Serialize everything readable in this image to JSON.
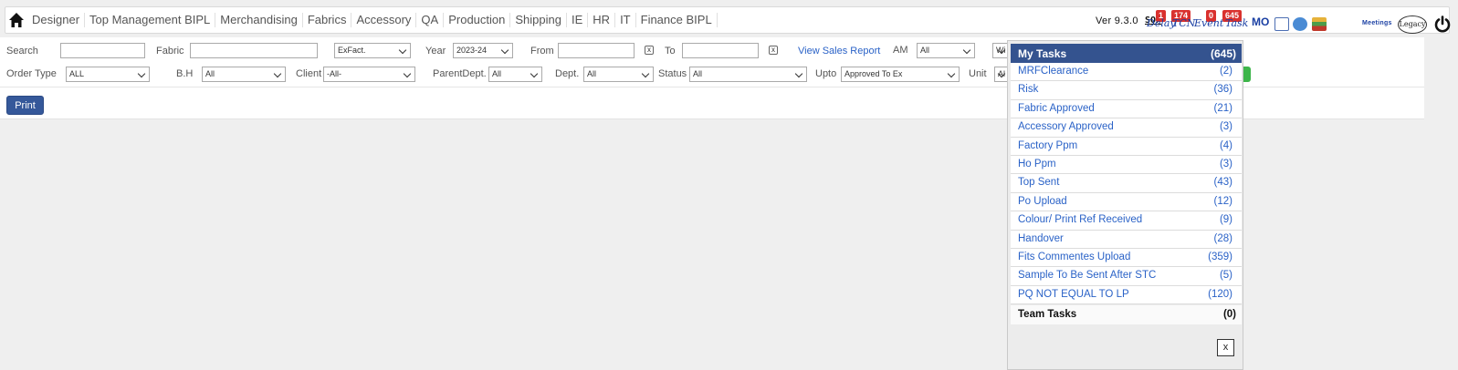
{
  "nav": {
    "items": [
      "Designer",
      "Top Management BIPL",
      "Merchandising",
      "Fabrics",
      "Accessory",
      "QA",
      "Production",
      "Shipping",
      "IE",
      "HR",
      "IT",
      "Finance BIPL"
    ],
    "version": "Ver 9.3.0",
    "sop": "SOP",
    "delay_label": "Delay",
    "delay_count": "1",
    "tcn_label": "TCN",
    "tcn_count": "174",
    "event_label": "Event",
    "event_count": "0",
    "task_label": "Task",
    "task_count": "645",
    "mo_label": "MO",
    "meetings": "Meetings",
    "legacy": "Legacy"
  },
  "filters": {
    "search_label": "Search",
    "fabric_label": "Fabric",
    "exfact_value": "ExFact.",
    "year_label": "Year",
    "year_value": "2023-24",
    "from_label": "From",
    "to_label": "To",
    "view_sales_report": "View Sales Report",
    "am_label": "AM",
    "am_value": "All",
    "wi_value": "Wi",
    "order_type_label": "Order Type",
    "order_type_value": "ALL",
    "bh_label": "B.H",
    "bh_value": "All",
    "client_label": "Client",
    "client_value": "-All-",
    "parent_dept_label": "ParentDept.",
    "parent_dept_value": "All",
    "dept_label": "Dept.",
    "dept_value": "All",
    "status_label": "Status",
    "status_value": "All",
    "upto_label": "Upto",
    "upto_value": "Approved To Ex",
    "unit_label": "Unit",
    "unit_value": "Al",
    "print_label": "Print"
  },
  "tasks": {
    "header_label": "My Tasks",
    "header_count": "(645)",
    "items": [
      {
        "label": "MRFClearance",
        "count": "(2)"
      },
      {
        "label": "Risk",
        "count": "(36)"
      },
      {
        "label": "Fabric Approved",
        "count": "(21)"
      },
      {
        "label": "Accessory Approved",
        "count": "(3)"
      },
      {
        "label": "Factory Ppm",
        "count": "(4)"
      },
      {
        "label": "Ho Ppm",
        "count": "(3)"
      },
      {
        "label": "Top Sent",
        "count": "(43)"
      },
      {
        "label": "Po Upload",
        "count": "(12)"
      },
      {
        "label": "Colour/ Print Ref Received",
        "count": "(9)"
      },
      {
        "label": "Handover",
        "count": "(28)"
      },
      {
        "label": "Fits Commentes Upload",
        "count": "(359)"
      },
      {
        "label": "Sample To Be Sent After STC",
        "count": "(5)"
      },
      {
        "label": "PQ NOT EQUAL TO LP",
        "count": "(120)"
      }
    ],
    "team_label": "Team Tasks",
    "team_count": "(0)",
    "close_label": "x"
  },
  "colors": {
    "accent": "#34538f",
    "badge": "#d9312e",
    "link": "#2a62c7"
  }
}
